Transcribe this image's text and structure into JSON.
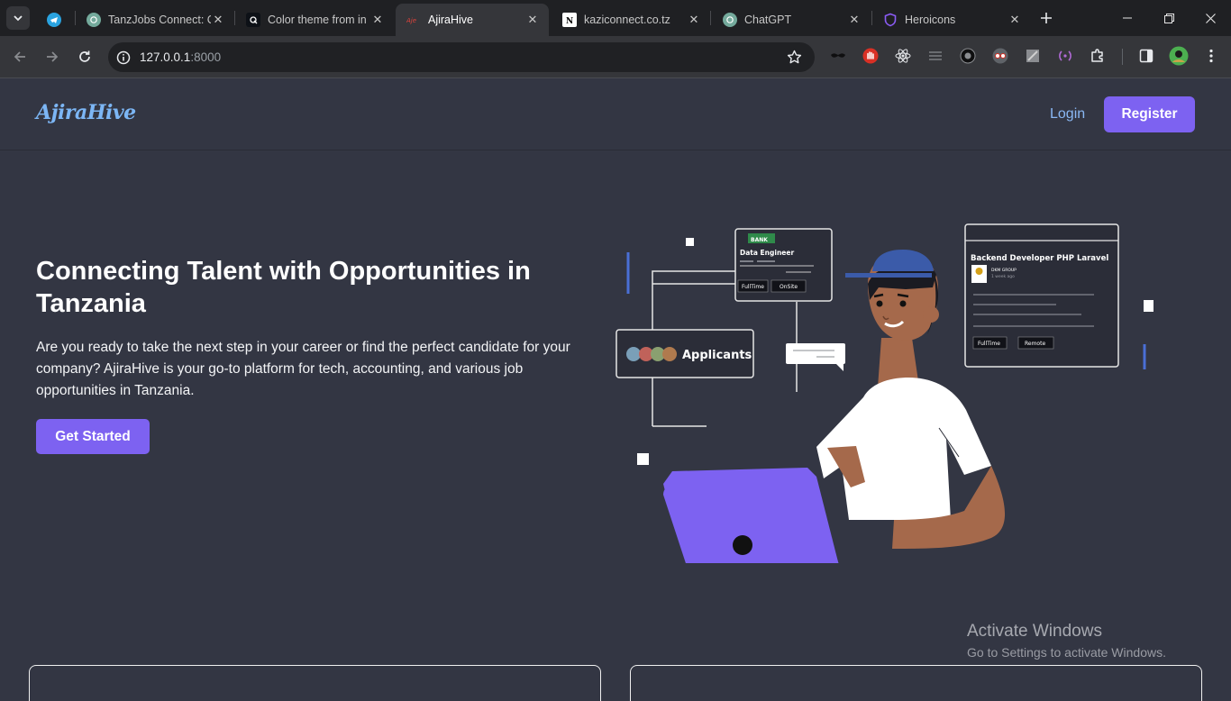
{
  "browser": {
    "tabs": [
      {
        "title": "",
        "icon": "telegram-icon"
      },
      {
        "title": "TanzJobs Connect: C",
        "icon": "chatgpt-icon"
      },
      {
        "title": "Color theme from in",
        "icon": "color-theme-icon"
      },
      {
        "title": "AjiraHive",
        "icon": "ajirahive-icon"
      },
      {
        "title": "kaziconnect.co.tz",
        "icon": "notion-icon"
      },
      {
        "title": "ChatGPT",
        "icon": "chatgpt-icon"
      },
      {
        "title": "Heroicons",
        "icon": "shield-icon"
      }
    ],
    "url_host": "127.0.0.1",
    "url_port": ":8000"
  },
  "site": {
    "logo": "AjiraHive",
    "login_label": "Login",
    "register_label": "Register"
  },
  "hero": {
    "title": "Connecting Talent with Opportunities in Tanzania",
    "description": "Are you ready to take the next step in your career or find the perfect candidate for your company? AjiraHive is your go-to platform for tech, accounting, and various job opportunities in Tanzania.",
    "cta_label": "Get Started"
  },
  "illustration": {
    "card1": {
      "badge": "BANK",
      "title": "Data Engineer",
      "tag1": "FullTime",
      "tag2": "OnSite"
    },
    "applicants_label": "Applicants",
    "card2": {
      "title": "Backend Developer PHP Laravel",
      "company": "DKM GROUP",
      "posted": "1 week ago",
      "tag1": "FullTime",
      "tag2": "Remote"
    }
  },
  "watermark": {
    "line1": "Activate Windows",
    "line2": "Go to Settings to activate Windows."
  },
  "colors": {
    "accent": "#7d62f1",
    "logo": "#7cb6f5",
    "background": "#333643"
  }
}
